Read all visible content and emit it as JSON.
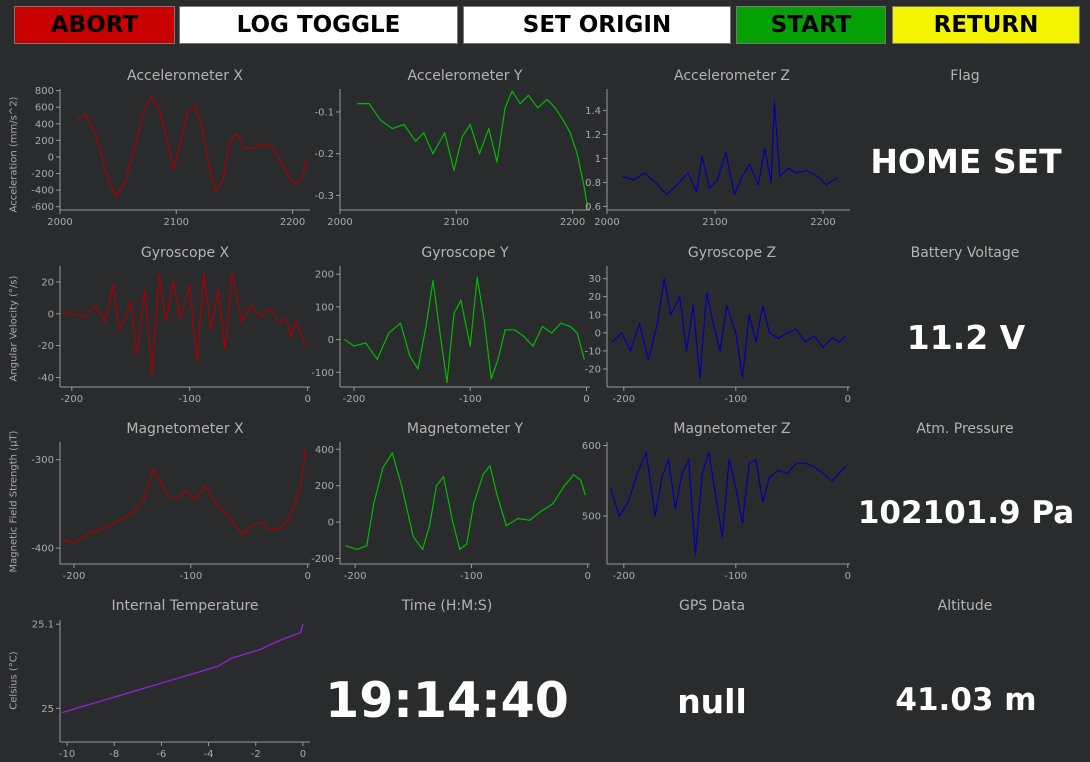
{
  "buttons": {
    "abort": "ABORT",
    "log_toggle": "LOG TOGGLE",
    "set_origin": "SET ORIGIN",
    "start": "START",
    "return": "RETURN"
  },
  "colors": {
    "abort": "#c80000",
    "log_toggle": "#ffffff",
    "set_origin": "#ffffff",
    "start": "#04a004",
    "return": "#f4f400",
    "background": "#2a2b2d",
    "trace_x": "#aa0000",
    "trace_y": "#00bb00",
    "trace_z": "#0000aa",
    "trace_temp": "#9a20e0"
  },
  "panels": {
    "flag": {
      "title": "Flag",
      "value": "HOME SET"
    },
    "battery": {
      "title": "Battery Voltage",
      "value": "11.2 V"
    },
    "pressure": {
      "title": "Atm. Pressure",
      "value": "102101.9 Pa"
    },
    "time": {
      "title": "Time (H:M:S)",
      "value": "19:14:40"
    },
    "gps": {
      "title": "GPS Data",
      "value": "null"
    },
    "altitude": {
      "title": "Altitude",
      "value": "41.03 m"
    }
  },
  "chart_data": [
    {
      "id": "accel_x",
      "type": "line",
      "title": "Accelerometer X",
      "ylabel": "Acceleration (mm/s^2)",
      "xlim": [
        2000,
        2215
      ],
      "ylim": [
        -640,
        820
      ],
      "xticks": [
        2000,
        2100,
        2200
      ],
      "yticks": [
        800,
        600,
        400,
        200,
        0,
        -200,
        -400,
        -600
      ],
      "color": "#aa0000",
      "series": [
        {
          "x": [
            2015,
            2022,
            2030,
            2040,
            2048,
            2056,
            2064,
            2072,
            2078,
            2085,
            2092,
            2098,
            2104,
            2110,
            2116,
            2123,
            2128,
            2134,
            2140,
            2146,
            2152,
            2158,
            2165,
            2172,
            2180,
            2188,
            2195,
            2202,
            2208,
            2213
          ],
          "y": [
            450,
            520,
            300,
            -200,
            -480,
            -300,
            100,
            550,
            720,
            600,
            200,
            -150,
            200,
            550,
            620,
            300,
            -100,
            -420,
            -280,
            200,
            280,
            120,
            100,
            140,
            150,
            0,
            -200,
            -330,
            -250,
            -30
          ]
        }
      ]
    },
    {
      "id": "accel_y",
      "type": "line",
      "title": "Accelerometer Y",
      "ylabel": "",
      "xlim": [
        2000,
        2215
      ],
      "ylim": [
        -0.335,
        -0.045
      ],
      "xticks": [
        2000,
        2100,
        2200
      ],
      "yticks": [
        -0.1,
        -0.2,
        -0.3
      ],
      "color": "#00bb00",
      "series": [
        {
          "x": [
            2015,
            2025,
            2035,
            2045,
            2055,
            2065,
            2072,
            2080,
            2090,
            2098,
            2105,
            2112,
            2120,
            2128,
            2135,
            2142,
            2148,
            2155,
            2162,
            2170,
            2178,
            2185,
            2192,
            2198,
            2204,
            2210,
            2213
          ],
          "y": [
            -0.08,
            -0.08,
            -0.12,
            -0.14,
            -0.13,
            -0.17,
            -0.15,
            -0.2,
            -0.15,
            -0.24,
            -0.16,
            -0.13,
            -0.2,
            -0.14,
            -0.22,
            -0.09,
            -0.05,
            -0.08,
            -0.06,
            -0.09,
            -0.07,
            -0.09,
            -0.12,
            -0.15,
            -0.2,
            -0.28,
            -0.33
          ]
        }
      ]
    },
    {
      "id": "accel_z",
      "type": "line",
      "title": "Accelerometer Z",
      "ylabel": "",
      "xlim": [
        2000,
        2225
      ],
      "ylim": [
        0.57,
        1.58
      ],
      "xticks": [
        2000,
        2100,
        2200
      ],
      "yticks": [
        1.4,
        1.2,
        1,
        0.8,
        0.6
      ],
      "color": "#0000aa",
      "series": [
        {
          "x": [
            2015,
            2025,
            2035,
            2045,
            2055,
            2065,
            2075,
            2083,
            2088,
            2095,
            2102,
            2110,
            2118,
            2125,
            2132,
            2140,
            2146,
            2152,
            2155,
            2160,
            2168,
            2175,
            2185,
            2195,
            2203,
            2210,
            2213
          ],
          "y": [
            0.85,
            0.82,
            0.88,
            0.8,
            0.7,
            0.78,
            0.88,
            0.72,
            1.02,
            0.75,
            0.82,
            1.05,
            0.7,
            0.85,
            0.95,
            0.78,
            1.08,
            0.8,
            1.48,
            0.85,
            0.92,
            0.88,
            0.9,
            0.85,
            0.78,
            0.82,
            0.84
          ]
        }
      ]
    },
    {
      "id": "gyro_x",
      "type": "line",
      "title": "Gyroscope X",
      "ylabel": "Angular Velocity (°/s)",
      "xlim": [
        -210,
        2
      ],
      "ylim": [
        -46,
        30
      ],
      "xticks": [
        -200,
        -100,
        0
      ],
      "yticks": [
        20,
        0,
        -20,
        -40
      ],
      "color": "#aa0000",
      "series": [
        {
          "x": [
            -208,
            -198,
            -190,
            -180,
            -172,
            -165,
            -160,
            -155,
            -150,
            -145,
            -138,
            -132,
            -126,
            -120,
            -114,
            -108,
            -100,
            -94,
            -88,
            -82,
            -76,
            -70,
            -64,
            -56,
            -48,
            -40,
            -32,
            -24,
            -18,
            -14,
            -10,
            -6,
            -2
          ],
          "y": [
            0,
            0,
            -2,
            5,
            -5,
            18,
            -10,
            -3,
            8,
            -25,
            15,
            -38,
            25,
            -5,
            20,
            -3,
            18,
            -30,
            25,
            -10,
            15,
            -22,
            25,
            -5,
            5,
            -2,
            3,
            -5,
            -3,
            -15,
            -5,
            -12,
            -20
          ]
        }
      ]
    },
    {
      "id": "gyro_y",
      "type": "line",
      "title": "Gyroscope Y",
      "ylabel": "",
      "xlim": [
        -212,
        3
      ],
      "ylim": [
        -145,
        225
      ],
      "xticks": [
        -200,
        -100,
        0
      ],
      "yticks": [
        200,
        100,
        0,
        -100
      ],
      "color": "#00bb00",
      "series": [
        {
          "x": [
            -208,
            -200,
            -190,
            -180,
            -170,
            -160,
            -152,
            -145,
            -138,
            -132,
            -126,
            -120,
            -114,
            -108,
            -100,
            -94,
            -88,
            -82,
            -76,
            -70,
            -62,
            -54,
            -46,
            -38,
            -30,
            -22,
            -14,
            -8,
            -2
          ],
          "y": [
            0,
            -20,
            -10,
            -60,
            20,
            50,
            -50,
            -90,
            40,
            180,
            20,
            -130,
            80,
            120,
            -20,
            190,
            60,
            -120,
            -60,
            30,
            30,
            10,
            -20,
            40,
            20,
            50,
            40,
            20,
            -60
          ]
        }
      ]
    },
    {
      "id": "gyro_z",
      "type": "line",
      "title": "Gyroscope Z",
      "ylabel": "",
      "xlim": [
        -215,
        2
      ],
      "ylim": [
        -30,
        37
      ],
      "xticks": [
        -200,
        -100,
        0
      ],
      "yticks": [
        30,
        20,
        10,
        0,
        -10,
        -20
      ],
      "color": "#0000aa",
      "series": [
        {
          "x": [
            -210,
            -202,
            -194,
            -186,
            -178,
            -170,
            -164,
            -158,
            -150,
            -144,
            -138,
            -132,
            -126,
            -120,
            -114,
            -108,
            -100,
            -94,
            -88,
            -82,
            -76,
            -70,
            -62,
            -54,
            -46,
            -38,
            -30,
            -22,
            -14,
            -8,
            -2
          ],
          "y": [
            -5,
            0,
            -10,
            5,
            -15,
            5,
            30,
            10,
            20,
            -10,
            15,
            -25,
            22,
            5,
            -10,
            15,
            0,
            -25,
            10,
            -5,
            15,
            0,
            -3,
            0,
            2,
            -5,
            -2,
            -8,
            -3,
            -5,
            -2
          ]
        }
      ]
    },
    {
      "id": "mag_x",
      "type": "line",
      "title": "Magnetometer X",
      "ylabel": "Magnetic Field Strength (µT)",
      "xlim": [
        -212,
        2
      ],
      "ylim": [
        -418,
        -280
      ],
      "xticks": [
        -200,
        -100,
        0
      ],
      "yticks": [
        -300,
        -400
      ],
      "color": "#aa0000",
      "series": [
        {
          "x": [
            -210,
            -200,
            -190,
            -180,
            -170,
            -160,
            -150,
            -140,
            -132,
            -126,
            -120,
            -112,
            -104,
            -96,
            -88,
            -80,
            -72,
            -64,
            -56,
            -48,
            -40,
            -32,
            -24,
            -16,
            -10,
            -6,
            -2
          ],
          "y": [
            -390,
            -395,
            -385,
            -380,
            -375,
            -368,
            -360,
            -345,
            -310,
            -325,
            -340,
            -345,
            -335,
            -345,
            -330,
            -345,
            -360,
            -370,
            -385,
            -375,
            -370,
            -380,
            -378,
            -368,
            -345,
            -330,
            -290
          ]
        }
      ]
    },
    {
      "id": "mag_y",
      "type": "line",
      "title": "Magnetometer Y",
      "ylabel": "",
      "xlim": [
        -213,
        2
      ],
      "ylim": [
        -230,
        440
      ],
      "xticks": [
        -200,
        -100,
        0
      ],
      "yticks": [
        400,
        200,
        0,
        -200
      ],
      "color": "#00bb00",
      "series": [
        {
          "x": [
            -208,
            -198,
            -190,
            -184,
            -176,
            -168,
            -160,
            -150,
            -142,
            -136,
            -130,
            -124,
            -116,
            -110,
            -104,
            -98,
            -90,
            -84,
            -78,
            -70,
            -60,
            -50,
            -40,
            -30,
            -20,
            -12,
            -6,
            -2
          ],
          "y": [
            -130,
            -150,
            -130,
            100,
            300,
            380,
            200,
            -80,
            -150,
            -20,
            200,
            250,
            0,
            -150,
            -120,
            100,
            260,
            310,
            150,
            -20,
            20,
            10,
            60,
            100,
            200,
            260,
            230,
            150
          ]
        }
      ]
    },
    {
      "id": "mag_z",
      "type": "line",
      "title": "Magnetometer Z",
      "ylabel": "",
      "xlim": [
        -215,
        2
      ],
      "ylim": [
        432,
        605
      ],
      "xticks": [
        -200,
        -100,
        0
      ],
      "yticks": [
        600,
        500
      ],
      "color": "#0000aa",
      "series": [
        {
          "x": [
            -212,
            -204,
            -196,
            -188,
            -180,
            -172,
            -166,
            -160,
            -154,
            -148,
            -142,
            -136,
            -130,
            -124,
            -118,
            -112,
            -106,
            -100,
            -94,
            -88,
            -82,
            -76,
            -70,
            -62,
            -54,
            -46,
            -38,
            -30,
            -22,
            -14,
            -8,
            -2
          ],
          "y": [
            540,
            500,
            520,
            560,
            590,
            500,
            555,
            580,
            510,
            560,
            580,
            445,
            560,
            590,
            530,
            470,
            580,
            540,
            490,
            575,
            580,
            520,
            555,
            565,
            560,
            575,
            575,
            570,
            560,
            550,
            560,
            570
          ]
        }
      ]
    },
    {
      "id": "temp",
      "type": "line",
      "title": "Internal Temperature",
      "ylabel": "Celsius (°C)",
      "xlim": [
        -10.3,
        0.3
      ],
      "ylim": [
        24.96,
        25.105
      ],
      "xticks": [
        -10,
        -8,
        -6,
        -4,
        -2,
        0
      ],
      "yticks": [
        25.1,
        25.0
      ],
      "color": "#9a20e0",
      "series": [
        {
          "x": [
            -10.2,
            -9.6,
            -9,
            -8.4,
            -7.8,
            -7.2,
            -6.6,
            -6,
            -5.4,
            -4.8,
            -4.2,
            -3.6,
            -3,
            -2.4,
            -1.8,
            -1.2,
            -0.6,
            -0.1,
            0
          ],
          "y": [
            24.995,
            25.0,
            25.005,
            25.01,
            25.015,
            25.02,
            25.025,
            25.03,
            25.035,
            25.04,
            25.045,
            25.05,
            25.06,
            25.065,
            25.07,
            25.078,
            25.085,
            25.09,
            25.1
          ]
        }
      ]
    }
  ]
}
